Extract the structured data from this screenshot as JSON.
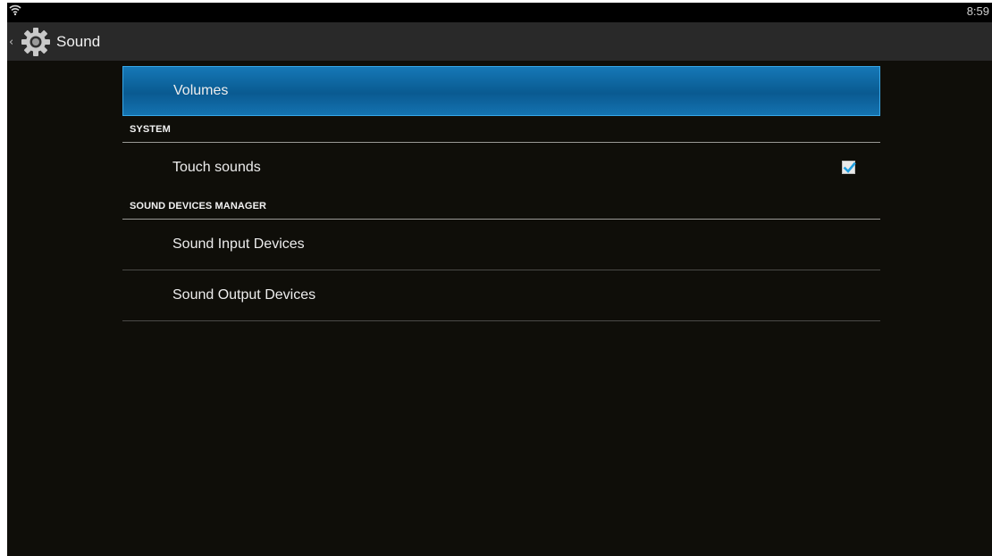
{
  "status_bar": {
    "time": "8:59",
    "wifi_icon": "wifi-icon"
  },
  "action_bar": {
    "title": "Sound",
    "back_icon": "chevron-left-icon",
    "app_icon": "gear-icon"
  },
  "list": {
    "volumes_label": "Volumes",
    "system_header": "SYSTEM",
    "touch_sounds_label": "Touch sounds",
    "touch_sounds_checked": true,
    "devices_header": "SOUND DEVICES MANAGER",
    "input_devices_label": "Sound Input Devices",
    "output_devices_label": "Sound Output Devices"
  },
  "colors": {
    "selected_row": "#0b5f97",
    "checkbox_check": "#1f9ee0",
    "background": "#0f0e09"
  }
}
